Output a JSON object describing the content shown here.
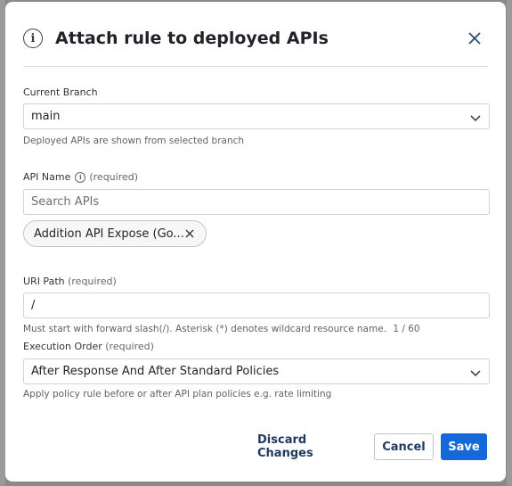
{
  "dialog": {
    "title": "Attach rule to deployed APIs",
    "info_icon": "info-circle-icon",
    "close_icon": "close-icon"
  },
  "branch": {
    "label": "Current Branch",
    "value": "main",
    "help": "Deployed APIs are shown from selected branch"
  },
  "api_name": {
    "label": "API Name",
    "required": "(required)",
    "placeholder": "Search APIs",
    "chip": "Addition API Expose (Go..."
  },
  "uri_path": {
    "label": "URI Path",
    "required": "(required)",
    "value": "/",
    "help": "Must start with forward slash(/). Asterisk (*) denotes wildcard resource name.",
    "counter": "1 / 60"
  },
  "execution_order": {
    "label": "Execution Order",
    "required": "(required)",
    "value": "After Response And After Standard Policies",
    "help": "Apply policy rule before or after API plan policies e.g. rate limiting"
  },
  "actions": {
    "discard": "Discard Changes",
    "cancel": "Cancel",
    "save": "Save"
  },
  "colors": {
    "primary": "#1468d8",
    "link": "#1f3a5f"
  }
}
